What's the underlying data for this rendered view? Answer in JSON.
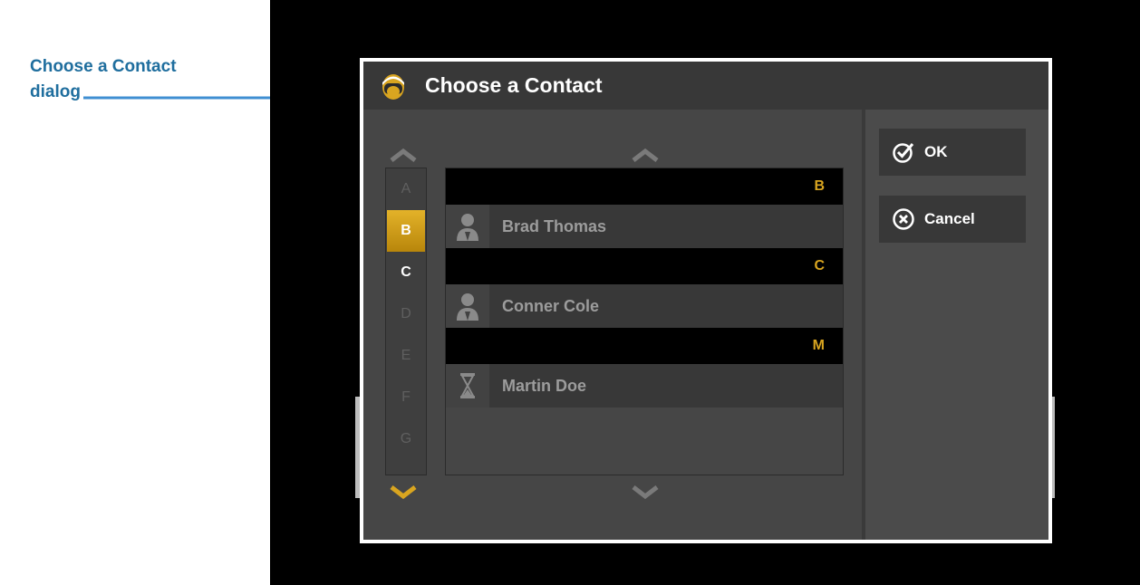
{
  "callout": {
    "label_line1": "Choose a Contact",
    "label_line2": "dialog"
  },
  "dialog": {
    "title": "Choose a Contact",
    "title_icon": "contact-head-icon",
    "ok_label": "OK",
    "cancel_label": "Cancel",
    "ok_icon": "checkmark-circle-icon",
    "cancel_icon": "x-circle-icon"
  },
  "alphabet": {
    "letters": [
      {
        "letter": "A",
        "state": "disabled"
      },
      {
        "letter": "B",
        "state": "selected"
      },
      {
        "letter": "C",
        "state": "enabled"
      },
      {
        "letter": "D",
        "state": "disabled"
      },
      {
        "letter": "E",
        "state": "disabled"
      },
      {
        "letter": "F",
        "state": "disabled"
      },
      {
        "letter": "G",
        "state": "disabled"
      }
    ]
  },
  "contacts": {
    "groups": [
      {
        "letter": "B",
        "entries": [
          {
            "name": "Brad Thomas",
            "icon": "person-icon"
          }
        ]
      },
      {
        "letter": "C",
        "entries": [
          {
            "name": "Conner Cole",
            "icon": "person-icon"
          }
        ]
      },
      {
        "letter": "M",
        "entries": [
          {
            "name": "Martin Doe",
            "icon": "hourglass-icon"
          }
        ]
      }
    ]
  },
  "colors": {
    "accent": "#d9a520",
    "callout": "#1f6e9e",
    "arrow": "#3f8fd2"
  }
}
